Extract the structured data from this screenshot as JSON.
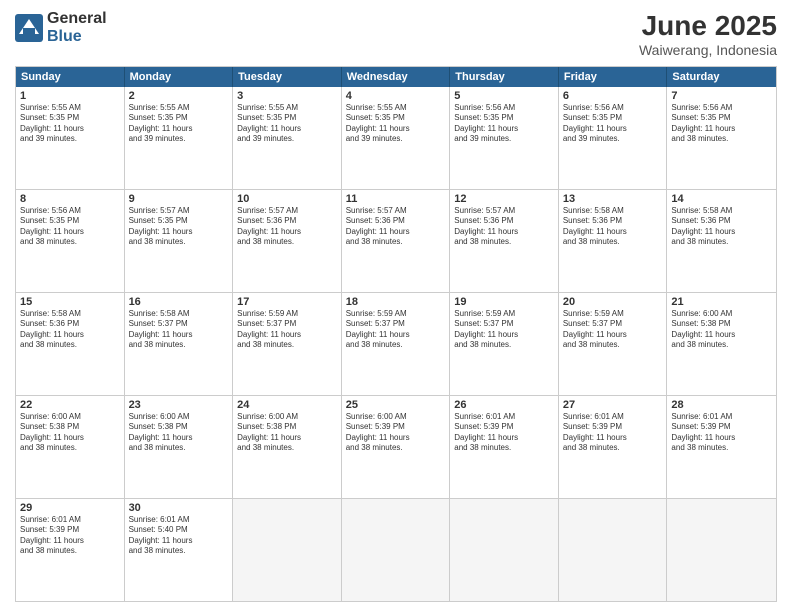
{
  "logo": {
    "general": "General",
    "blue": "Blue"
  },
  "title": "June 2025",
  "location": "Waiwerang, Indonesia",
  "header_days": [
    "Sunday",
    "Monday",
    "Tuesday",
    "Wednesday",
    "Thursday",
    "Friday",
    "Saturday"
  ],
  "rows": [
    [
      {
        "day": "1",
        "lines": [
          "Sunrise: 5:55 AM",
          "Sunset: 5:35 PM",
          "Daylight: 11 hours",
          "and 39 minutes."
        ]
      },
      {
        "day": "2",
        "lines": [
          "Sunrise: 5:55 AM",
          "Sunset: 5:35 PM",
          "Daylight: 11 hours",
          "and 39 minutes."
        ]
      },
      {
        "day": "3",
        "lines": [
          "Sunrise: 5:55 AM",
          "Sunset: 5:35 PM",
          "Daylight: 11 hours",
          "and 39 minutes."
        ]
      },
      {
        "day": "4",
        "lines": [
          "Sunrise: 5:55 AM",
          "Sunset: 5:35 PM",
          "Daylight: 11 hours",
          "and 39 minutes."
        ]
      },
      {
        "day": "5",
        "lines": [
          "Sunrise: 5:56 AM",
          "Sunset: 5:35 PM",
          "Daylight: 11 hours",
          "and 39 minutes."
        ]
      },
      {
        "day": "6",
        "lines": [
          "Sunrise: 5:56 AM",
          "Sunset: 5:35 PM",
          "Daylight: 11 hours",
          "and 39 minutes."
        ]
      },
      {
        "day": "7",
        "lines": [
          "Sunrise: 5:56 AM",
          "Sunset: 5:35 PM",
          "Daylight: 11 hours",
          "and 38 minutes."
        ]
      }
    ],
    [
      {
        "day": "8",
        "lines": [
          "Sunrise: 5:56 AM",
          "Sunset: 5:35 PM",
          "Daylight: 11 hours",
          "and 38 minutes."
        ]
      },
      {
        "day": "9",
        "lines": [
          "Sunrise: 5:57 AM",
          "Sunset: 5:35 PM",
          "Daylight: 11 hours",
          "and 38 minutes."
        ]
      },
      {
        "day": "10",
        "lines": [
          "Sunrise: 5:57 AM",
          "Sunset: 5:36 PM",
          "Daylight: 11 hours",
          "and 38 minutes."
        ]
      },
      {
        "day": "11",
        "lines": [
          "Sunrise: 5:57 AM",
          "Sunset: 5:36 PM",
          "Daylight: 11 hours",
          "and 38 minutes."
        ]
      },
      {
        "day": "12",
        "lines": [
          "Sunrise: 5:57 AM",
          "Sunset: 5:36 PM",
          "Daylight: 11 hours",
          "and 38 minutes."
        ]
      },
      {
        "day": "13",
        "lines": [
          "Sunrise: 5:58 AM",
          "Sunset: 5:36 PM",
          "Daylight: 11 hours",
          "and 38 minutes."
        ]
      },
      {
        "day": "14",
        "lines": [
          "Sunrise: 5:58 AM",
          "Sunset: 5:36 PM",
          "Daylight: 11 hours",
          "and 38 minutes."
        ]
      }
    ],
    [
      {
        "day": "15",
        "lines": [
          "Sunrise: 5:58 AM",
          "Sunset: 5:36 PM",
          "Daylight: 11 hours",
          "and 38 minutes."
        ]
      },
      {
        "day": "16",
        "lines": [
          "Sunrise: 5:58 AM",
          "Sunset: 5:37 PM",
          "Daylight: 11 hours",
          "and 38 minutes."
        ]
      },
      {
        "day": "17",
        "lines": [
          "Sunrise: 5:59 AM",
          "Sunset: 5:37 PM",
          "Daylight: 11 hours",
          "and 38 minutes."
        ]
      },
      {
        "day": "18",
        "lines": [
          "Sunrise: 5:59 AM",
          "Sunset: 5:37 PM",
          "Daylight: 11 hours",
          "and 38 minutes."
        ]
      },
      {
        "day": "19",
        "lines": [
          "Sunrise: 5:59 AM",
          "Sunset: 5:37 PM",
          "Daylight: 11 hours",
          "and 38 minutes."
        ]
      },
      {
        "day": "20",
        "lines": [
          "Sunrise: 5:59 AM",
          "Sunset: 5:37 PM",
          "Daylight: 11 hours",
          "and 38 minutes."
        ]
      },
      {
        "day": "21",
        "lines": [
          "Sunrise: 6:00 AM",
          "Sunset: 5:38 PM",
          "Daylight: 11 hours",
          "and 38 minutes."
        ]
      }
    ],
    [
      {
        "day": "22",
        "lines": [
          "Sunrise: 6:00 AM",
          "Sunset: 5:38 PM",
          "Daylight: 11 hours",
          "and 38 minutes."
        ]
      },
      {
        "day": "23",
        "lines": [
          "Sunrise: 6:00 AM",
          "Sunset: 5:38 PM",
          "Daylight: 11 hours",
          "and 38 minutes."
        ]
      },
      {
        "day": "24",
        "lines": [
          "Sunrise: 6:00 AM",
          "Sunset: 5:38 PM",
          "Daylight: 11 hours",
          "and 38 minutes."
        ]
      },
      {
        "day": "25",
        "lines": [
          "Sunrise: 6:00 AM",
          "Sunset: 5:39 PM",
          "Daylight: 11 hours",
          "and 38 minutes."
        ]
      },
      {
        "day": "26",
        "lines": [
          "Sunrise: 6:01 AM",
          "Sunset: 5:39 PM",
          "Daylight: 11 hours",
          "and 38 minutes."
        ]
      },
      {
        "day": "27",
        "lines": [
          "Sunrise: 6:01 AM",
          "Sunset: 5:39 PM",
          "Daylight: 11 hours",
          "and 38 minutes."
        ]
      },
      {
        "day": "28",
        "lines": [
          "Sunrise: 6:01 AM",
          "Sunset: 5:39 PM",
          "Daylight: 11 hours",
          "and 38 minutes."
        ]
      }
    ],
    [
      {
        "day": "29",
        "lines": [
          "Sunrise: 6:01 AM",
          "Sunset: 5:39 PM",
          "Daylight: 11 hours",
          "and 38 minutes."
        ]
      },
      {
        "day": "30",
        "lines": [
          "Sunrise: 6:01 AM",
          "Sunset: 5:40 PM",
          "Daylight: 11 hours",
          "and 38 minutes."
        ]
      },
      {
        "day": "",
        "lines": []
      },
      {
        "day": "",
        "lines": []
      },
      {
        "day": "",
        "lines": []
      },
      {
        "day": "",
        "lines": []
      },
      {
        "day": "",
        "lines": []
      }
    ]
  ]
}
